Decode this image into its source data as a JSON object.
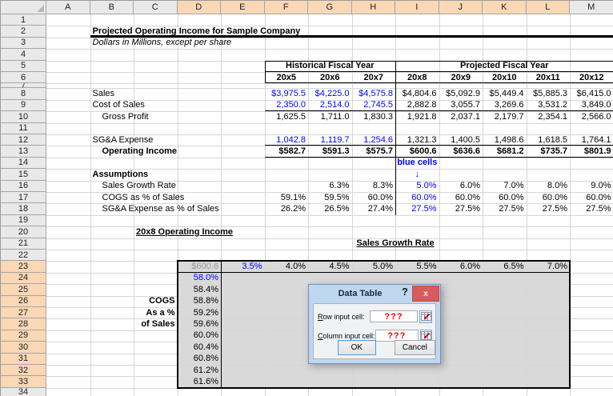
{
  "colors": {
    "blue_text": "#0000ff",
    "grey_text": "#999999",
    "selection_header_bg": "#fad7b5",
    "header_bg": "#e9e9e9",
    "gridline": "#d6d6d6",
    "table_fill": "#d9d9d9",
    "dialog_frame": "#bed7ef",
    "close_button_red": "#d85a5e",
    "input_value_red": "#ee0000"
  },
  "columns": [
    "A",
    "B",
    "C",
    "D",
    "E",
    "F",
    "G",
    "H",
    "I",
    "J",
    "K",
    "L",
    "M"
  ],
  "row_labels": [
    "1",
    "2",
    "3",
    "4",
    "5",
    "6",
    "7",
    "8",
    "9",
    "10",
    "11",
    "12",
    "13",
    "14",
    "15",
    "16",
    "17",
    "18",
    "19",
    "20",
    "21",
    "22",
    "23",
    "24",
    "25",
    "26",
    "27",
    "28",
    "29",
    "30",
    "31",
    "32",
    "33",
    "34"
  ],
  "selection": {
    "columns": [
      "D",
      "E",
      "F",
      "G",
      "H",
      "I",
      "J",
      "K",
      "L"
    ],
    "rows": [
      23,
      24,
      25,
      26,
      27,
      28,
      29,
      30,
      31,
      32,
      33
    ]
  },
  "cells": [
    {
      "r": 2,
      "c": "B",
      "c2": "M",
      "t": "Projected Operating Income for Sample Company",
      "k": "lblb"
    },
    {
      "r": 3,
      "c": "B",
      "c2": "M",
      "t": "Dollars in Millions, except per share",
      "k": "itl"
    },
    {
      "r": 5,
      "c": "F",
      "c2": "H",
      "t": "Historical Fiscal Year",
      "k": "hdrc"
    },
    {
      "r": 5,
      "c": "I",
      "c2": "M",
      "t": "Projected Fiscal Year",
      "k": "hdrc"
    },
    {
      "r": 6,
      "c": "F",
      "t": "20x5",
      "k": "yearc"
    },
    {
      "r": 6,
      "c": "G",
      "t": "20x6",
      "k": "yearc"
    },
    {
      "r": 6,
      "c": "H",
      "t": "20x7",
      "k": "yearc"
    },
    {
      "r": 6,
      "c": "I",
      "t": "20x8",
      "k": "yearc"
    },
    {
      "r": 6,
      "c": "J",
      "t": "20x9",
      "k": "yearc"
    },
    {
      "r": 6,
      "c": "K",
      "t": "20x10",
      "k": "yearc"
    },
    {
      "r": 6,
      "c": "L",
      "t": "20x11",
      "k": "yearc"
    },
    {
      "r": 6,
      "c": "M",
      "t": "20x12",
      "k": "yearc"
    },
    {
      "r": 8,
      "c": "B",
      "t": "Sales",
      "k": "lbl"
    },
    {
      "r": 8,
      "c": "F",
      "t": "$3,975.5",
      "k": "numblue"
    },
    {
      "r": 8,
      "c": "G",
      "t": "$4,225.0",
      "k": "numblue"
    },
    {
      "r": 8,
      "c": "H",
      "t": "$4,575.8",
      "k": "numblue"
    },
    {
      "r": 8,
      "c": "I",
      "t": "$4,804.6",
      "k": "num"
    },
    {
      "r": 8,
      "c": "J",
      "t": "$5,092.9",
      "k": "num"
    },
    {
      "r": 8,
      "c": "K",
      "t": "$5,449.4",
      "k": "num"
    },
    {
      "r": 8,
      "c": "L",
      "t": "$5,885.3",
      "k": "num"
    },
    {
      "r": 8,
      "c": "M",
      "t": "$6,415.0",
      "k": "num"
    },
    {
      "r": 9,
      "c": "B",
      "t": "Cost of Sales",
      "k": "lbl"
    },
    {
      "r": 9,
      "c": "F",
      "t": "2,350.0",
      "k": "numblue"
    },
    {
      "r": 9,
      "c": "G",
      "t": "2,514.0",
      "k": "numblue"
    },
    {
      "r": 9,
      "c": "H",
      "t": "2,745.5",
      "k": "numblue"
    },
    {
      "r": 9,
      "c": "I",
      "t": "2,882.8",
      "k": "num"
    },
    {
      "r": 9,
      "c": "J",
      "t": "3,055.7",
      "k": "num"
    },
    {
      "r": 9,
      "c": "K",
      "t": "3,269.6",
      "k": "num"
    },
    {
      "r": 9,
      "c": "L",
      "t": "3,531.2",
      "k": "num"
    },
    {
      "r": 9,
      "c": "M",
      "t": "3,849.0",
      "k": "num"
    },
    {
      "r": 10,
      "c": "B",
      "t": "Gross Profit",
      "k": "ind"
    },
    {
      "r": 10,
      "c": "F",
      "t": "1,625.5",
      "k": "num"
    },
    {
      "r": 10,
      "c": "G",
      "t": "1,711.0",
      "k": "num"
    },
    {
      "r": 10,
      "c": "H",
      "t": "1,830.3",
      "k": "num"
    },
    {
      "r": 10,
      "c": "I",
      "t": "1,921.8",
      "k": "num"
    },
    {
      "r": 10,
      "c": "J",
      "t": "2,037.1",
      "k": "num"
    },
    {
      "r": 10,
      "c": "K",
      "t": "2,179.7",
      "k": "num"
    },
    {
      "r": 10,
      "c": "L",
      "t": "2,354.1",
      "k": "num"
    },
    {
      "r": 10,
      "c": "M",
      "t": "2,566.0",
      "k": "num"
    },
    {
      "r": 12,
      "c": "B",
      "t": "SG&A Expense",
      "k": "lbl"
    },
    {
      "r": 12,
      "c": "F",
      "t": "1,042.8",
      "k": "numblue"
    },
    {
      "r": 12,
      "c": "G",
      "t": "1,119.7",
      "k": "numblue"
    },
    {
      "r": 12,
      "c": "H",
      "t": "1,254.6",
      "k": "numblue"
    },
    {
      "r": 12,
      "c": "I",
      "t": "1,321.3",
      "k": "num"
    },
    {
      "r": 12,
      "c": "J",
      "t": "1,400.5",
      "k": "num"
    },
    {
      "r": 12,
      "c": "K",
      "t": "1,498.6",
      "k": "num"
    },
    {
      "r": 12,
      "c": "L",
      "t": "1,618.5",
      "k": "num"
    },
    {
      "r": 12,
      "c": "M",
      "t": "1,764.1",
      "k": "num"
    },
    {
      "r": 13,
      "c": "B",
      "t": "Operating Income",
      "k": "indb"
    },
    {
      "r": 13,
      "c": "F",
      "t": "$582.7",
      "k": "numb"
    },
    {
      "r": 13,
      "c": "G",
      "t": "$591.3",
      "k": "numb"
    },
    {
      "r": 13,
      "c": "H",
      "t": "$575.7",
      "k": "numb"
    },
    {
      "r": 13,
      "c": "I",
      "t": "$600.6",
      "k": "numb"
    },
    {
      "r": 13,
      "c": "J",
      "t": "$636.6",
      "k": "numb"
    },
    {
      "r": 13,
      "c": "K",
      "t": "$681.2",
      "k": "numb"
    },
    {
      "r": 13,
      "c": "L",
      "t": "$735.7",
      "k": "numb"
    },
    {
      "r": 13,
      "c": "M",
      "t": "$801.9",
      "k": "numb"
    },
    {
      "r": 14,
      "c": "I",
      "t": "blue cells",
      "k": "ctrblueb"
    },
    {
      "r": 15,
      "c": "B",
      "t": "Assumptions",
      "k": "lblb"
    },
    {
      "r": 15,
      "c": "I",
      "t": "↓",
      "k": "ctrblueb"
    },
    {
      "r": 16,
      "c": "B",
      "c2": "E",
      "t": "Sales Growth Rate",
      "k": "ind"
    },
    {
      "r": 16,
      "c": "G",
      "t": "6.3%",
      "k": "num"
    },
    {
      "r": 16,
      "c": "H",
      "t": "8.3%",
      "k": "num"
    },
    {
      "r": 16,
      "c": "I",
      "t": "5.0%",
      "k": "numblue"
    },
    {
      "r": 16,
      "c": "J",
      "t": "6.0%",
      "k": "num"
    },
    {
      "r": 16,
      "c": "K",
      "t": "7.0%",
      "k": "num"
    },
    {
      "r": 16,
      "c": "L",
      "t": "8.0%",
      "k": "num"
    },
    {
      "r": 16,
      "c": "M",
      "t": "9.0%",
      "k": "num"
    },
    {
      "r": 17,
      "c": "B",
      "c2": "E",
      "t": "COGS as % of Sales",
      "k": "ind"
    },
    {
      "r": 17,
      "c": "F",
      "t": "59.1%",
      "k": "num"
    },
    {
      "r": 17,
      "c": "G",
      "t": "59.5%",
      "k": "num"
    },
    {
      "r": 17,
      "c": "H",
      "t": "60.0%",
      "k": "num"
    },
    {
      "r": 17,
      "c": "I",
      "t": "60.0%",
      "k": "numblue"
    },
    {
      "r": 17,
      "c": "J",
      "t": "60.0%",
      "k": "num"
    },
    {
      "r": 17,
      "c": "K",
      "t": "60.0%",
      "k": "num"
    },
    {
      "r": 17,
      "c": "L",
      "t": "60.0%",
      "k": "num"
    },
    {
      "r": 17,
      "c": "M",
      "t": "60.0%",
      "k": "num"
    },
    {
      "r": 18,
      "c": "B",
      "c2": "E",
      "t": "SG&A Expense as % of Sales",
      "k": "ind"
    },
    {
      "r": 18,
      "c": "F",
      "t": "26.2%",
      "k": "num"
    },
    {
      "r": 18,
      "c": "G",
      "t": "26.5%",
      "k": "num"
    },
    {
      "r": 18,
      "c": "H",
      "t": "27.4%",
      "k": "num"
    },
    {
      "r": 18,
      "c": "I",
      "t": "27.5%",
      "k": "numblue"
    },
    {
      "r": 18,
      "c": "J",
      "t": "27.5%",
      "k": "num"
    },
    {
      "r": 18,
      "c": "K",
      "t": "27.5%",
      "k": "num"
    },
    {
      "r": 18,
      "c": "L",
      "t": "27.5%",
      "k": "num"
    },
    {
      "r": 18,
      "c": "M",
      "t": "27.5%",
      "k": "num"
    },
    {
      "r": 20,
      "c": "C",
      "c2": "E",
      "t": "20x8 Operating Income",
      "k": "ub"
    },
    {
      "r": 21,
      "c": "G",
      "c2": "J",
      "t": "Sales Growth Rate",
      "k": "ubc"
    },
    {
      "r": 23,
      "c": "D",
      "t": "$600.6",
      "k": "numgrey"
    },
    {
      "r": 23,
      "c": "E",
      "t": "3.5%",
      "k": "numblue"
    },
    {
      "r": 23,
      "c": "F",
      "t": "4.0%",
      "k": "num"
    },
    {
      "r": 23,
      "c": "G",
      "t": "4.5%",
      "k": "num"
    },
    {
      "r": 23,
      "c": "H",
      "t": "5.0%",
      "k": "num"
    },
    {
      "r": 23,
      "c": "I",
      "t": "5.5%",
      "k": "num"
    },
    {
      "r": 23,
      "c": "J",
      "t": "6.0%",
      "k": "num"
    },
    {
      "r": 23,
      "c": "K",
      "t": "6.5%",
      "k": "num"
    },
    {
      "r": 23,
      "c": "L",
      "t": "7.0%",
      "k": "num"
    },
    {
      "r": 24,
      "c": "D",
      "t": "58.0%",
      "k": "numblue"
    },
    {
      "r": 25,
      "c": "D",
      "t": "58.4%",
      "k": "num"
    },
    {
      "r": 26,
      "c": "C",
      "t": "COGS",
      "k": "rb"
    },
    {
      "r": 26,
      "c": "D",
      "t": "58.8%",
      "k": "num"
    },
    {
      "r": 27,
      "c": "C",
      "t": "As a %",
      "k": "rb"
    },
    {
      "r": 27,
      "c": "D",
      "t": "59.2%",
      "k": "num"
    },
    {
      "r": 28,
      "c": "C",
      "t": "of Sales",
      "k": "rb"
    },
    {
      "r": 28,
      "c": "D",
      "t": "59.6%",
      "k": "num"
    },
    {
      "r": 29,
      "c": "D",
      "t": "60.0%",
      "k": "num"
    },
    {
      "r": 30,
      "c": "D",
      "t": "60.4%",
      "k": "num"
    },
    {
      "r": 31,
      "c": "D",
      "t": "60.8%",
      "k": "num"
    },
    {
      "r": 32,
      "c": "D",
      "t": "61.2%",
      "k": "num"
    },
    {
      "r": 33,
      "c": "D",
      "t": "61.6%",
      "k": "num"
    }
  ],
  "dialog": {
    "title": "Data Table",
    "help": "?",
    "close": "x",
    "row_field": {
      "accel": "R",
      "rest": "ow input cell:",
      "value": "???"
    },
    "col_field": {
      "accel": "C",
      "rest": "olumn input cell:",
      "value": "???"
    },
    "ok": "OK",
    "cancel": "Cancel"
  }
}
